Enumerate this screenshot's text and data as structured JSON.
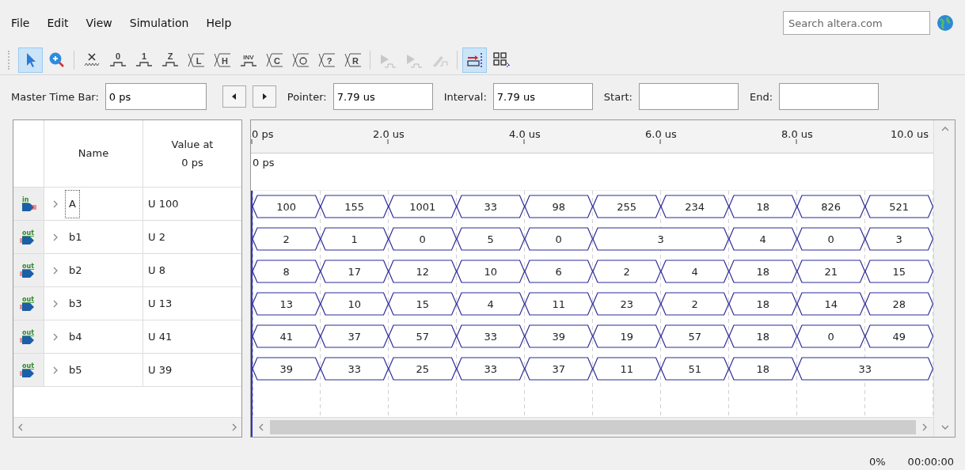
{
  "menu": [
    "File",
    "Edit",
    "View",
    "Simulation",
    "Help"
  ],
  "search": {
    "placeholder": "Search altera.com"
  },
  "toolbar": [
    {
      "kind": "pointer",
      "selected": true,
      "disabled": false
    },
    {
      "kind": "zoom",
      "selected": false,
      "disabled": false
    },
    {
      "kind": "separator"
    },
    {
      "kind": "unknown",
      "selected": false,
      "disabled": false
    },
    {
      "kind": "level",
      "glyph": "0",
      "selected": false,
      "disabled": false
    },
    {
      "kind": "level",
      "glyph": "1",
      "selected": false,
      "disabled": false
    },
    {
      "kind": "level",
      "glyph": "Z",
      "selected": false,
      "disabled": false
    },
    {
      "kind": "transition",
      "glyph": "L",
      "selected": false,
      "disabled": false
    },
    {
      "kind": "transition",
      "glyph": "H",
      "selected": false,
      "disabled": false
    },
    {
      "kind": "level",
      "glyph": "INV",
      "selected": false,
      "disabled": false
    },
    {
      "kind": "transition",
      "glyph": "C",
      "selected": false,
      "disabled": false
    },
    {
      "kind": "clock",
      "selected": false,
      "disabled": false
    },
    {
      "kind": "transition",
      "glyph": "?",
      "selected": false,
      "disabled": false
    },
    {
      "kind": "transition",
      "glyph": "R",
      "selected": false,
      "disabled": false
    },
    {
      "kind": "separator"
    },
    {
      "kind": "run",
      "selected": false,
      "disabled": true
    },
    {
      "kind": "run",
      "selected": false,
      "disabled": true
    },
    {
      "kind": "wand",
      "selected": false,
      "disabled": true
    },
    {
      "kind": "separator"
    },
    {
      "kind": "snap",
      "selected": true,
      "disabled": false
    },
    {
      "kind": "group",
      "selected": false,
      "disabled": false
    }
  ],
  "time_bar": {
    "master_label": "Master Time Bar:",
    "master_value": "0 ps",
    "fields": [
      {
        "label": "Pointer:",
        "value": "7.79 us"
      },
      {
        "label": "Interval:",
        "value": "7.79 us"
      },
      {
        "label": "Start:"
      },
      {
        "label": "End:"
      }
    ]
  },
  "signal_table": {
    "columns": [
      "Name",
      "Value at\n0 ps"
    ],
    "rows": [
      {
        "direction": "in",
        "name": "A",
        "value": "U 100",
        "expanded": false,
        "focused": true
      },
      {
        "direction": "out",
        "name": "b1",
        "value": "U 2",
        "expanded": false,
        "focused": false
      },
      {
        "direction": "out",
        "name": "b2",
        "value": "U 8",
        "expanded": false,
        "focused": false
      },
      {
        "direction": "out",
        "name": "b3",
        "value": "U 13",
        "expanded": false,
        "focused": false
      },
      {
        "direction": "out",
        "name": "b4",
        "value": "U 41",
        "expanded": false,
        "focused": false
      },
      {
        "direction": "out",
        "name": "b5",
        "value": "U 39",
        "expanded": false,
        "focused": false
      }
    ]
  },
  "waveform": {
    "ruler": [
      "0 ps",
      "2.0 us",
      "4.0 us",
      "6.0 us",
      "8.0 us",
      "10.0 us"
    ],
    "marker": "0 ps",
    "rows": [
      {
        "segments": [
          {
            "value": "100",
            "double": false
          },
          {
            "value": "155",
            "double": false
          },
          {
            "value": "1001",
            "double": false
          },
          {
            "value": "33",
            "double": false
          },
          {
            "value": "98",
            "double": false
          },
          {
            "value": "255",
            "double": false
          },
          {
            "value": "234",
            "double": false
          },
          {
            "value": "18",
            "double": false
          },
          {
            "value": "826",
            "double": false
          },
          {
            "value": "521",
            "double": false
          }
        ]
      },
      {
        "segments": [
          {
            "value": "2",
            "double": false
          },
          {
            "value": "1",
            "double": false
          },
          {
            "value": "0",
            "double": false
          },
          {
            "value": "5",
            "double": false
          },
          {
            "value": "0",
            "double": false
          },
          {
            "value": "3",
            "double": true
          },
          {
            "value": "4",
            "double": false
          },
          {
            "value": "0",
            "double": false
          },
          {
            "value": "3",
            "double": false
          }
        ]
      },
      {
        "segments": [
          {
            "value": "8",
            "double": false
          },
          {
            "value": "17",
            "double": false
          },
          {
            "value": "12",
            "double": false
          },
          {
            "value": "10",
            "double": false
          },
          {
            "value": "6",
            "double": false
          },
          {
            "value": "2",
            "double": false
          },
          {
            "value": "4",
            "double": false
          },
          {
            "value": "18",
            "double": false
          },
          {
            "value": "21",
            "double": false
          },
          {
            "value": "15",
            "double": false
          }
        ]
      },
      {
        "segments": [
          {
            "value": "13",
            "double": false
          },
          {
            "value": "10",
            "double": false
          },
          {
            "value": "15",
            "double": false
          },
          {
            "value": "4",
            "double": false
          },
          {
            "value": "11",
            "double": false
          },
          {
            "value": "23",
            "double": false
          },
          {
            "value": "2",
            "double": false
          },
          {
            "value": "18",
            "double": false
          },
          {
            "value": "14",
            "double": false
          },
          {
            "value": "28",
            "double": false
          }
        ]
      },
      {
        "segments": [
          {
            "value": "41",
            "double": false
          },
          {
            "value": "37",
            "double": false
          },
          {
            "value": "57",
            "double": false
          },
          {
            "value": "33",
            "double": false
          },
          {
            "value": "39",
            "double": false
          },
          {
            "value": "19",
            "double": false
          },
          {
            "value": "57",
            "double": false
          },
          {
            "value": "18",
            "double": false
          },
          {
            "value": "0",
            "double": false
          },
          {
            "value": "49",
            "double": false
          }
        ]
      },
      {
        "segments": [
          {
            "value": "39",
            "double": false
          },
          {
            "value": "33",
            "double": false
          },
          {
            "value": "25",
            "double": false
          },
          {
            "value": "33",
            "double": false
          },
          {
            "value": "37",
            "double": false
          },
          {
            "value": "11",
            "double": false
          },
          {
            "value": "51",
            "double": false
          },
          {
            "value": "18",
            "double": false
          },
          {
            "value": "33",
            "double": true
          }
        ]
      }
    ]
  },
  "status_bar": {
    "progress": "0%",
    "elapsed": "00:00:00"
  }
}
